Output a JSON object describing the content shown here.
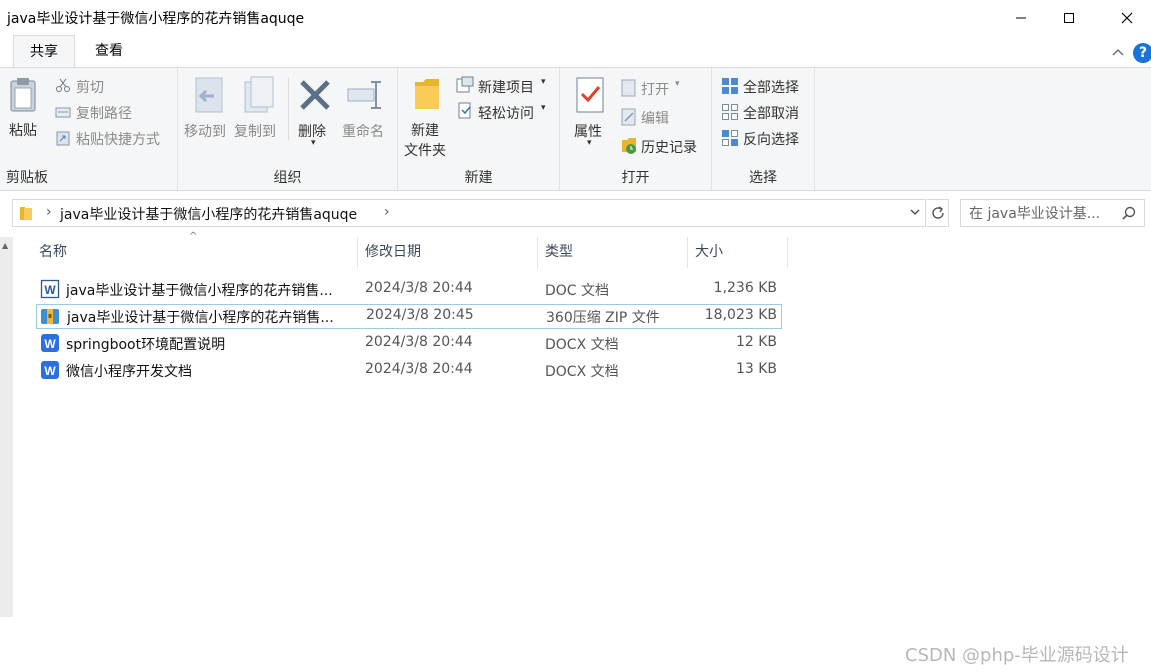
{
  "window": {
    "title": "java毕业设计基于微信小程序的花卉销售aquqe"
  },
  "tabs": [
    {
      "label": "共享"
    },
    {
      "label": "查看"
    }
  ],
  "ribbon": {
    "clipboard": {
      "group_label": "剪贴板",
      "paste": "粘贴",
      "cut": "剪切",
      "copy_path": "复制路径",
      "paste_shortcut": "粘贴快捷方式"
    },
    "organize": {
      "group_label": "组织",
      "move_to": "移动到",
      "copy_to": "复制到",
      "delete": "删除",
      "rename": "重命名"
    },
    "new": {
      "group_label": "新建",
      "new_item": "新建项目",
      "easy_access": "轻松访问",
      "new_folder_line1": "新建",
      "new_folder_line2": "文件夹"
    },
    "open": {
      "group_label": "打开",
      "properties": "属性",
      "open": "打开",
      "edit": "编辑",
      "history": "历史记录"
    },
    "select": {
      "group_label": "选择",
      "select_all": "全部选择",
      "select_none": "全部取消",
      "invert": "反向选择"
    }
  },
  "address": {
    "path": "java毕业设计基于微信小程序的花卉销售aquqe",
    "search_placeholder": "在 java毕业设计基..."
  },
  "columns": {
    "name": "名称",
    "date": "修改日期",
    "type": "类型",
    "size": "大小"
  },
  "files": [
    {
      "name": "java毕业设计基于微信小程序的花卉销售...",
      "date": "2024/3/8 20:44",
      "type": "DOC 文档",
      "size": "1,236 KB",
      "icon": "word-doc-icon"
    },
    {
      "name": "java毕业设计基于微信小程序的花卉销售...",
      "date": "2024/3/8 20:45",
      "type": "360压缩 ZIP 文件",
      "size": "18,023 KB",
      "icon": "zip-archive-icon"
    },
    {
      "name": "springboot环境配置说明",
      "date": "2024/3/8 20:44",
      "type": "DOCX 文档",
      "size": "12 KB",
      "icon": "wps-doc-icon"
    },
    {
      "name": "微信小程序开发文档",
      "date": "2024/3/8 20:44",
      "type": "DOCX 文档",
      "size": "13 KB",
      "icon": "wps-doc-icon"
    }
  ],
  "watermark": "CSDN @php-毕业源码设计",
  "colors": {
    "accent": "#1a73d9",
    "ribbon_bg": "#f5f6f7",
    "selection_border": "#99c9ef"
  }
}
